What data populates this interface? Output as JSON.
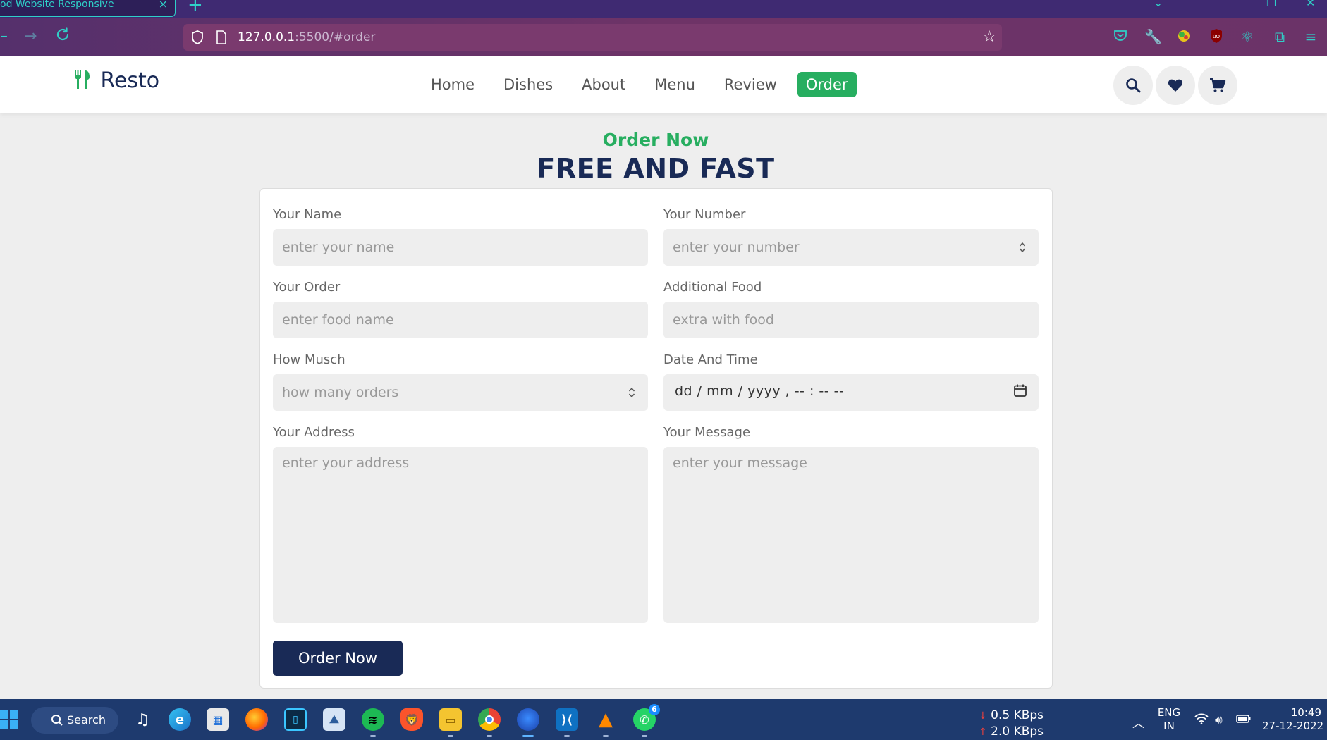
{
  "browser": {
    "tab_title": "od Website Responsive",
    "tab_close": "×",
    "new_tab": "+",
    "url_host": "127.0.0.1",
    "url_path": ":5500/#order"
  },
  "site": {
    "logo_text": "Resto",
    "nav": [
      {
        "label": "Home"
      },
      {
        "label": "Dishes"
      },
      {
        "label": "About"
      },
      {
        "label": "Menu"
      },
      {
        "label": "Review"
      },
      {
        "label": "Order"
      }
    ],
    "icons": [
      "search-icon",
      "heart-icon",
      "cart-icon"
    ]
  },
  "order": {
    "sub_heading": "Order Now",
    "heading": "FREE AND FAST",
    "fields": {
      "name": {
        "label": "Your Name",
        "placeholder": "enter your name"
      },
      "number": {
        "label": "Your Number",
        "placeholder": "enter your number"
      },
      "food": {
        "label": "Your Order",
        "placeholder": "enter food name"
      },
      "additional": {
        "label": "Additional Food",
        "placeholder": "extra with food"
      },
      "quantity": {
        "label": "How Musch",
        "placeholder": "how many orders"
      },
      "datetime": {
        "label": "Date And Time",
        "value": "dd / mm / yyyy ,  -- : --   --"
      },
      "address": {
        "label": "Your Address",
        "placeholder": "enter your address"
      },
      "message": {
        "label": "Your Message",
        "placeholder": "enter your message"
      }
    },
    "submit_label": "Order Now"
  },
  "taskbar": {
    "search_label": "Search",
    "whatsapp_badge": "6",
    "net_down": "0.5 KBps",
    "net_up": "2.0 KBps",
    "lang_top": "ENG",
    "lang_bottom": "IN",
    "time": "10:49",
    "date": "27-12-2022",
    "accent_color": "#27ae60",
    "primary_color": "#192a56"
  }
}
